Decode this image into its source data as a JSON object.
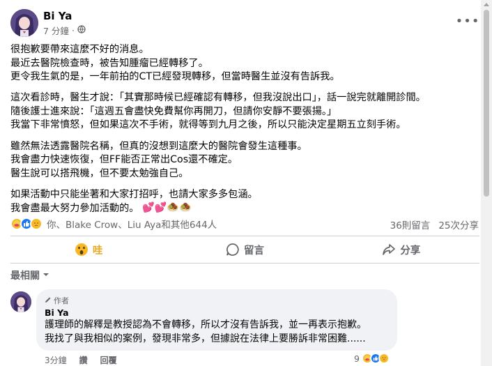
{
  "post": {
    "author": "Bi Ya",
    "time": "7 分鐘",
    "separator": "·",
    "paragraphs": [
      [
        "很抱歉要帶來這麼不好的消息。",
        "最近去醫院檢查時，被告知腫瘤已經轉移了。",
        "更令我生氣的是，一年前拍的CT已經發現轉移，但當時醫生並沒有告訴我。"
      ],
      [
        "這次看診時，醫生才說：「其實那時候已經確認有轉移，但我沒說出口」，話一說完就離開診間。",
        "隨後護士進來說：「這週五會盡快免費幫你再開刀，但請你安靜不要張揚。」",
        "我當下非常憤怒，但如果這次不手術，就得等到九月之後，所以只能決定星期五立刻手術。"
      ],
      [
        "雖然無法透露醫院名稱，但真的沒想到這麼大的醫院會發生這種事。",
        "我會盡力快速恢復，但FF能否正常出Cos還不確定。",
        "醫生說可以搭飛機，但不要太勉強自己。"
      ],
      [
        "如果活動中只能坐著和大家打招呼，也請大家多多包涵。",
        "我會盡最大努力參加活動的。"
      ]
    ],
    "end_emojis": "💕💕🧆🧆"
  },
  "reactions": {
    "icons": [
      "care",
      "like",
      "sad"
    ],
    "names_text": "你、Blake Crow、Liu Aya和其他644人",
    "comments_count": "36則留言",
    "shares_count": "25次分享"
  },
  "actions": {
    "react_label": "哇",
    "comment_label": "留言",
    "share_label": "分享"
  },
  "comments": {
    "sort_label": "最相關",
    "items": [
      {
        "badge": "作者",
        "author": "Bi Ya",
        "lines": [
          "護理師的解釋是教授認為不會轉移，所以才沒有告訴我，並一再表示抱歉。",
          "我找了與我相似的案例，發現非常多，但據說在法律上要勝訴非常困難......"
        ],
        "time": "3分鐘",
        "like_label": "讚",
        "reply_label": "回覆",
        "reaction_count": "9"
      }
    ]
  },
  "colors": {
    "like_blue": "#1877f2",
    "care_yellow": "#f7b928",
    "secondary_text": "#65676b",
    "bubble_bg": "#f0f2f5"
  }
}
